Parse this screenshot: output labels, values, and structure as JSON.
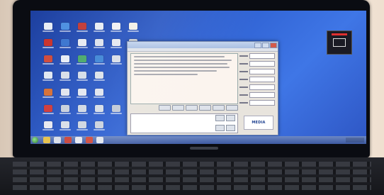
{
  "window": {
    "title": "",
    "logo_text": "MEDIA"
  },
  "desktop": {
    "icon_count": 34
  },
  "colors": {
    "desktop_blue": "#2d5fd0",
    "window_face": "#e8e4dd",
    "taskbar": "#3d5aa2"
  },
  "icons": {
    "gadget": "pen-tablet-gadget-icon",
    "start": "start-orb-icon"
  }
}
